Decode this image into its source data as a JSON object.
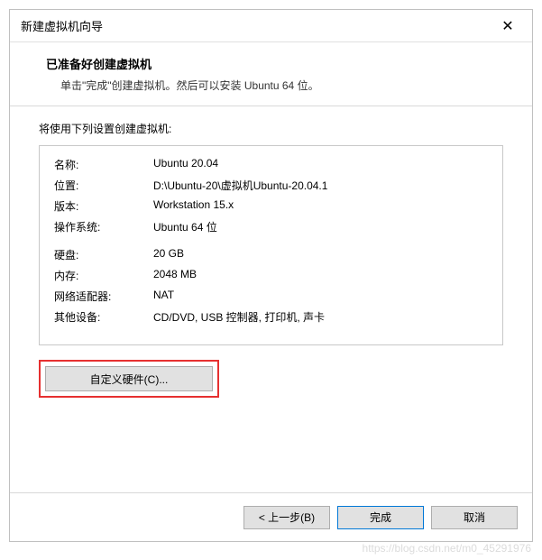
{
  "titlebar": {
    "title": "新建虚拟机向导"
  },
  "header": {
    "title": "已准备好创建虚拟机",
    "subtitle": "单击\"完成\"创建虚拟机。然后可以安装 Ubuntu 64 位。"
  },
  "intro": "将使用下列设置创建虚拟机:",
  "settings": {
    "name_label": "名称:",
    "name_value": "Ubuntu 20.04",
    "location_label": "位置:",
    "location_value": "D:\\Ubuntu-20\\虚拟机Ubuntu-20.04.1",
    "version_label": "版本:",
    "version_value": "Workstation 15.x",
    "os_label": "操作系统:",
    "os_value": "Ubuntu 64 位",
    "disk_label": "硬盘:",
    "disk_value": "20 GB",
    "memory_label": "内存:",
    "memory_value": "2048 MB",
    "network_label": "网络适配器:",
    "network_value": "NAT",
    "other_label": "其他设备:",
    "other_value": "CD/DVD, USB 控制器, 打印机, 声卡"
  },
  "buttons": {
    "customize": "自定义硬件(C)...",
    "back": "< 上一步(B)",
    "finish": "完成",
    "cancel": "取消"
  },
  "watermark": "https://blog.csdn.net/m0_45291976"
}
